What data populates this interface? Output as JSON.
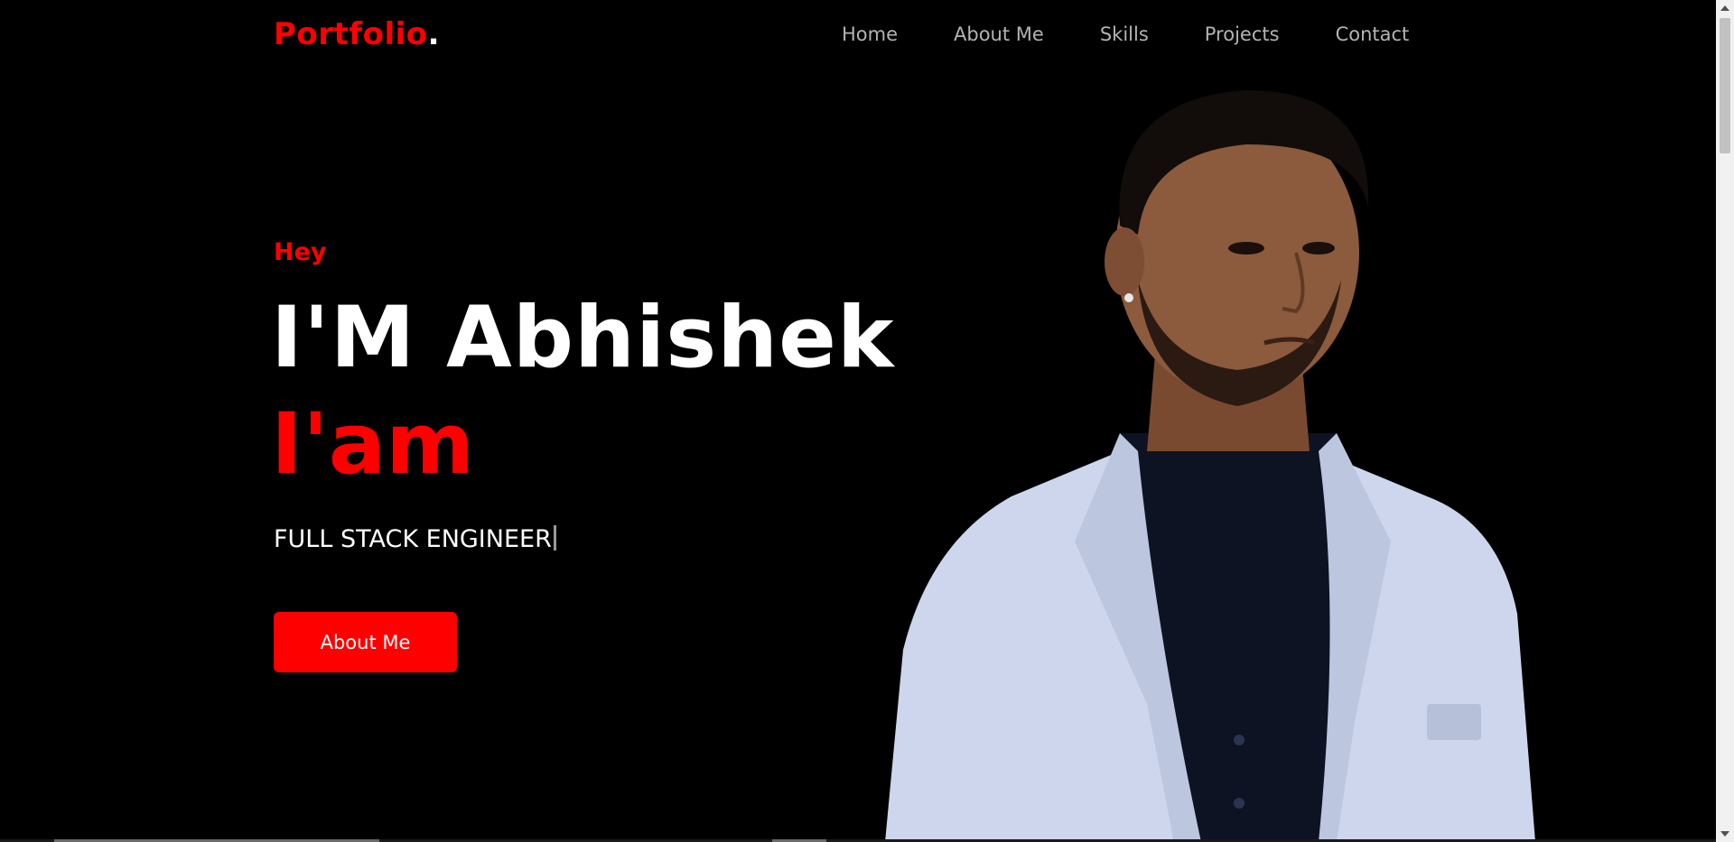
{
  "header": {
    "brand": "Portfolio",
    "brand_dot": ".",
    "nav": [
      "Home",
      "About Me",
      "Skills",
      "Projects",
      "Contact"
    ]
  },
  "hero": {
    "greeting": "Hey",
    "name": "I'M Abhishek",
    "iam": "I'am",
    "role": "FULL STACK ENGINEER",
    "cta_label": "About Me"
  },
  "colors": {
    "accent": "#ff0000",
    "background": "#000000",
    "text": "#ffffff",
    "nav_text": "#b3b3b3"
  }
}
